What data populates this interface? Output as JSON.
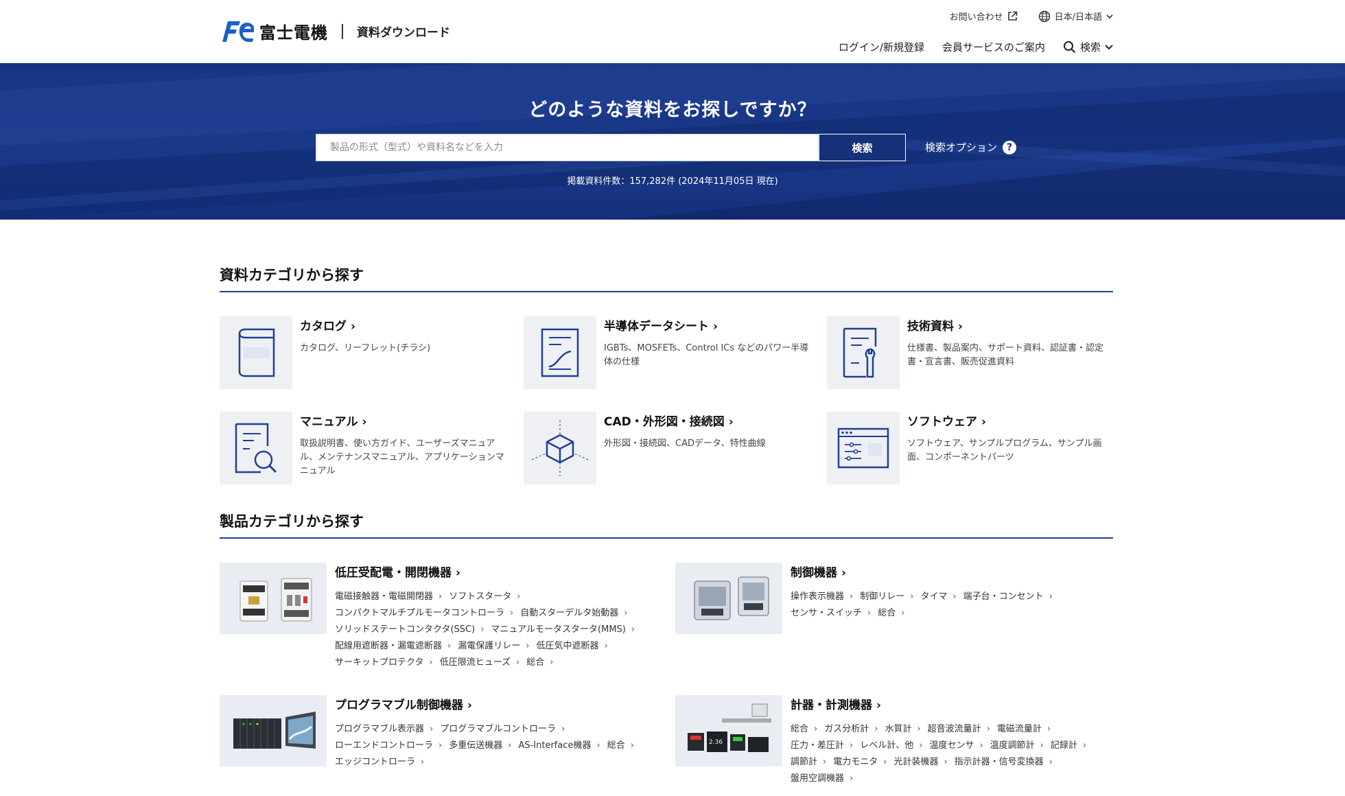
{
  "header": {
    "logo_text": "富士電機",
    "site_name": "資料ダウンロード",
    "contact": "お問い合わせ",
    "language": "日本/日本語",
    "login": "ログイン/新規登録",
    "member_service": "会員サービスのご案内",
    "search": "検索"
  },
  "hero": {
    "title": "どのような資料をお探しですか？",
    "search_placeholder": "製品の形式（型式）や資料名などを入力",
    "search_button": "検索",
    "search_options": "検索オプション",
    "count_text": "掲載資料件数：157,282件 (2024年11月05日 現在)"
  },
  "doc_section": {
    "title": "資料カテゴリから探す",
    "items": [
      {
        "name": "カタログ",
        "desc": "カタログ、リーフレット(チラシ)",
        "icon": "catalog-icon"
      },
      {
        "name": "半導体データシート",
        "desc": "IGBTs、MOSFETs、Control ICs などのパワー半導体の仕様",
        "icon": "datasheet-icon"
      },
      {
        "name": "技術資料",
        "desc": "仕様書、製品案内、サポート資料、認証書・認定書・宣言書、販売促進資料",
        "icon": "technical-doc-icon"
      },
      {
        "name": "マニュアル",
        "desc": "取扱説明書、使い方ガイド、ユーザーズマニュアル、メンテナンスマニュアル、アプリケーションマニュアル",
        "icon": "manual-icon"
      },
      {
        "name": "CAD・外形図・接続図",
        "desc": "外形図・接続図、CADデータ、特性曲線",
        "icon": "cad-cube-icon"
      },
      {
        "name": "ソフトウェア",
        "desc": "ソフトウェア、サンプルプログラム、サンプル画面、コンポーネントパーツ",
        "icon": "software-icon"
      }
    ]
  },
  "product_section": {
    "title": "製品カテゴリから探す",
    "items": [
      {
        "name": "低圧受配電・開閉機器",
        "image": "contactor-image",
        "links": [
          "電磁接触器・電磁開閉器",
          "ソフトスタータ",
          "コンパクトマルチプルモータコントローラ",
          "自動スターデルタ始動器",
          "ソリッドステートコンタクタ(SSC)",
          "マニュアルモータスタータ(MMS)",
          "配線用遮断器・漏電遮断器",
          "漏電保護リレー",
          "低圧気中遮断器",
          "サーキットプロテクタ",
          "低圧限流ヒューズ",
          "総合"
        ]
      },
      {
        "name": "制御機器",
        "image": "relay-image",
        "links": [
          "操作表示機器",
          "制御リレー",
          "タイマ",
          "端子台・コンセント",
          "センサ・スイッチ",
          "総合"
        ]
      },
      {
        "name": "プログラマブル制御機器",
        "image": "plc-image",
        "links": [
          "プログラマブル表示器",
          "プログラマブルコントローラ",
          "ローエンドコントローラ",
          "多重伝送機器",
          "AS-Interface機器",
          "総合",
          "エッジコントローラ"
        ]
      },
      {
        "name": "計器・計測機器",
        "image": "meter-image",
        "links": [
          "総合",
          "ガス分析計",
          "水質計",
          "超音波流量計",
          "電磁流量計",
          "圧力・差圧計",
          "レベル計、他",
          "温度センサ",
          "温度調節計",
          "記録計",
          "調節計",
          "電力モニタ",
          "光計装機器",
          "指示計器・信号変換器",
          "盤用空調機器"
        ]
      }
    ]
  },
  "colors": {
    "brand_blue": "#17307a",
    "section_line": "#1f3f95"
  }
}
